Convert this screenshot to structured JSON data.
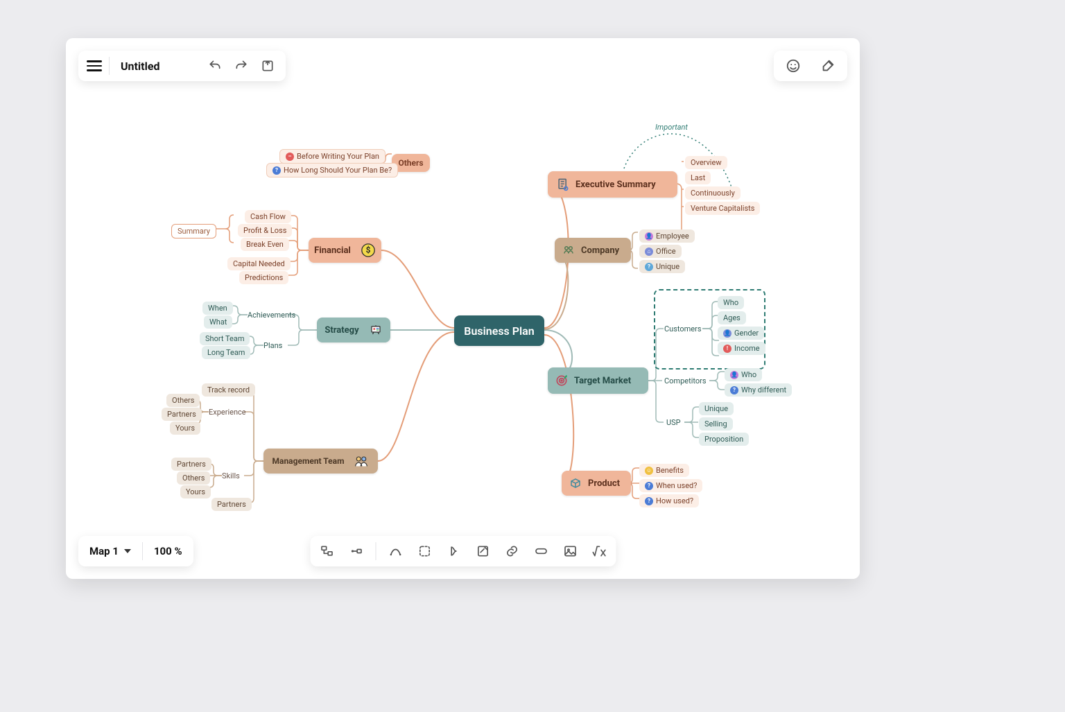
{
  "app": {
    "title": "Untitled"
  },
  "bottom": {
    "map_name": "Map 1",
    "zoom": "100 %"
  },
  "center": {
    "label": "Business Plan"
  },
  "branches": {
    "exec": {
      "label": "Executive Summary",
      "children": [
        "Overview",
        "Last",
        "Continuously",
        "Venture Capitalists"
      ],
      "annotation": "Important"
    },
    "company": {
      "label": "Company",
      "children": [
        "Employee",
        "Office",
        "Unique"
      ]
    },
    "target": {
      "label": "Target Market",
      "customers": {
        "label": "Customers",
        "children": [
          "Who",
          "Ages",
          "Gender",
          "Income"
        ]
      },
      "competitors": {
        "label": "Competitors",
        "children": [
          "Who",
          "Why different"
        ]
      },
      "usp": {
        "label": "USP",
        "children": [
          "Unique",
          "Selling",
          "Proposition"
        ]
      }
    },
    "product": {
      "label": "Product",
      "children": [
        "Benefits",
        "When used?",
        "How used?"
      ]
    },
    "financial": {
      "label": "Financial",
      "children": [
        "Cash Flow",
        "Profit & Loss",
        "Break Even",
        "Capital Needed",
        "Predictions"
      ],
      "summary": "Summary"
    },
    "strategy": {
      "label": "Strategy",
      "achievements": {
        "label": "Achievements",
        "children": [
          "When",
          "What"
        ]
      },
      "plans": {
        "label": "Plans",
        "children": [
          "Short Team",
          "Long Team"
        ]
      }
    },
    "mgmt": {
      "label": "Management Team",
      "track": "Track record",
      "experience": {
        "label": "Experience",
        "children": [
          "Others",
          "Partners",
          "Yours"
        ]
      },
      "skills": {
        "label": "Skills",
        "children": [
          "Partners",
          "Others",
          "Yours"
        ]
      },
      "last": "Partners"
    },
    "others": {
      "label": "Others",
      "children": [
        "Before Writing Your Plan",
        "How Long Should Your Plan Be?"
      ]
    }
  },
  "colors": {
    "center": "#2f6469",
    "center_txt": "#fff",
    "peach": "#f0b69a",
    "peach_light": "#fceee6",
    "peach_txt": "#7a3f28",
    "brown": "#c9ab8d",
    "brown_light": "#efe7de",
    "brown_txt": "#5f4633",
    "teal": "#95bab5",
    "teal_light": "#e3edec",
    "teal_txt": "#2e5b55",
    "annot": "#2f7c73"
  }
}
